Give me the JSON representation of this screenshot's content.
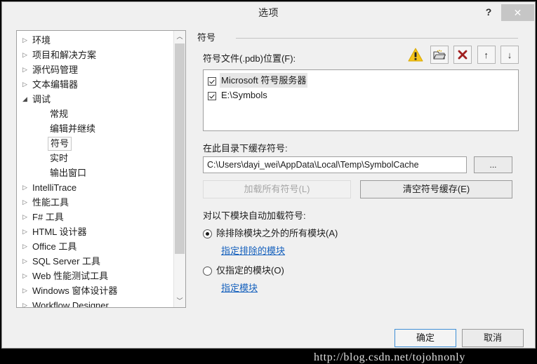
{
  "window": {
    "title": "选项",
    "help_label": "?",
    "close_label": "✕"
  },
  "tree": {
    "items": [
      {
        "label": "环境",
        "arrow": "▷",
        "level": 0,
        "expanded": false,
        "selected": false
      },
      {
        "label": "项目和解决方案",
        "arrow": "▷",
        "level": 0,
        "expanded": false,
        "selected": false
      },
      {
        "label": "源代码管理",
        "arrow": "▷",
        "level": 0,
        "expanded": false,
        "selected": false
      },
      {
        "label": "文本编辑器",
        "arrow": "▷",
        "level": 0,
        "expanded": false,
        "selected": false
      },
      {
        "label": "调试",
        "arrow": "◢",
        "level": 0,
        "expanded": true,
        "selected": false
      },
      {
        "label": "常规",
        "arrow": "",
        "level": 1,
        "expanded": false,
        "selected": false
      },
      {
        "label": "编辑并继续",
        "arrow": "",
        "level": 1,
        "expanded": false,
        "selected": false
      },
      {
        "label": "符号",
        "arrow": "",
        "level": 1,
        "expanded": false,
        "selected": true
      },
      {
        "label": "实时",
        "arrow": "",
        "level": 1,
        "expanded": false,
        "selected": false
      },
      {
        "label": "输出窗口",
        "arrow": "",
        "level": 1,
        "expanded": false,
        "selected": false
      },
      {
        "label": "IntelliTrace",
        "arrow": "▷",
        "level": 0,
        "expanded": false,
        "selected": false
      },
      {
        "label": "性能工具",
        "arrow": "▷",
        "level": 0,
        "expanded": false,
        "selected": false
      },
      {
        "label": "F# 工具",
        "arrow": "▷",
        "level": 0,
        "expanded": false,
        "selected": false
      },
      {
        "label": "HTML 设计器",
        "arrow": "▷",
        "level": 0,
        "expanded": false,
        "selected": false
      },
      {
        "label": "Office 工具",
        "arrow": "▷",
        "level": 0,
        "expanded": false,
        "selected": false
      },
      {
        "label": "SQL Server 工具",
        "arrow": "▷",
        "level": 0,
        "expanded": false,
        "selected": false
      },
      {
        "label": "Web 性能测试工具",
        "arrow": "▷",
        "level": 0,
        "expanded": false,
        "selected": false
      },
      {
        "label": "Windows 窗体设计器",
        "arrow": "▷",
        "level": 0,
        "expanded": false,
        "selected": false
      },
      {
        "label": "Workflow Designer",
        "arrow": "▷",
        "level": 0,
        "expanded": false,
        "selected": false
      }
    ],
    "scroll_up": "︿",
    "scroll_down": "﹀"
  },
  "panel": {
    "section_title": "符号",
    "symbol_file_label": "符号文件(.pdb)位置(F):",
    "toolbar": [
      {
        "name": "warning-icon",
        "tip": "warning"
      },
      {
        "name": "new-location-icon",
        "tip": "新建"
      },
      {
        "name": "delete-icon",
        "tip": "删除"
      },
      {
        "name": "move-up-icon",
        "tip": "上移",
        "glyph": "↑"
      },
      {
        "name": "move-down-icon",
        "tip": "下移",
        "glyph": "↓"
      }
    ],
    "symbol_locations": [
      {
        "label": "Microsoft 符号服务器",
        "checked": true,
        "selected": true
      },
      {
        "label": "E:\\Symbols",
        "checked": true,
        "selected": false
      }
    ],
    "cache_label": "在此目录下缓存符号:",
    "cache_value": "C:\\Users\\dayi_wei\\AppData\\Local\\Temp\\SymbolCache",
    "cache_placeholder": "",
    "browse_label": "...",
    "load_all_label": "加载所有符号(L)",
    "clear_cache_label": "清空符号缓存(E)",
    "auto_load_label": "对以下模块自动加载符号:",
    "radio_all_label": "除排除模块之外的所有模块(A)",
    "radio_all_selected": true,
    "link_exclude_label": "指定排除的模块",
    "radio_only_label": "仅指定的模块(O)",
    "radio_only_selected": false,
    "link_specify_label": "指定模块"
  },
  "footer": {
    "ok_label": "确定",
    "cancel_label": "取消"
  },
  "watermark": "http://blog.csdn.net/tojohnonly",
  "colors": {
    "accent": "#3f8fd6",
    "link": "#1560bd",
    "warning": "#f5c518",
    "delete": "#a02020",
    "dialog_bg": "#f0f0f0"
  }
}
